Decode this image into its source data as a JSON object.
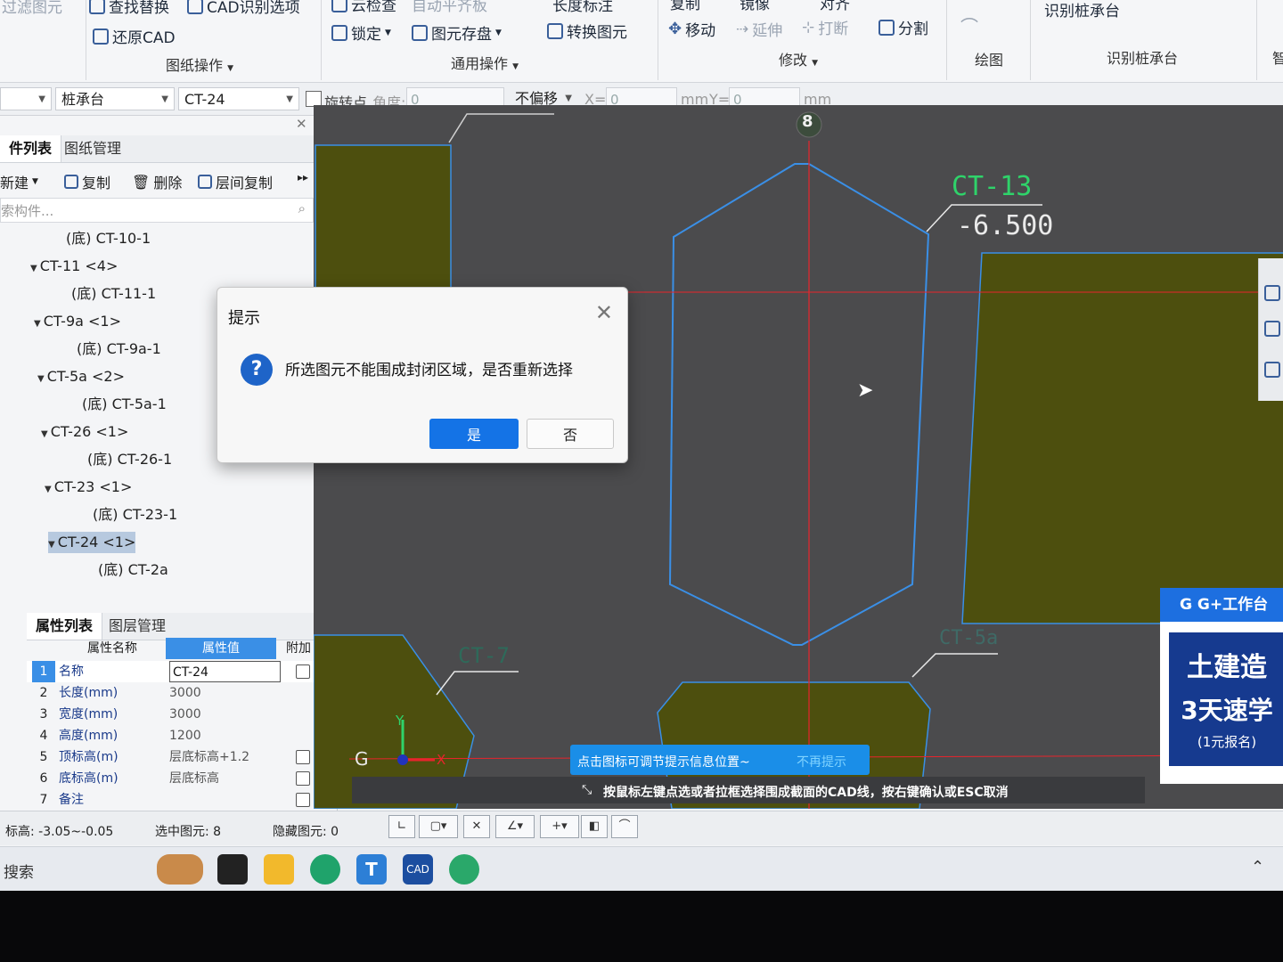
{
  "ribbon": {
    "top_row": [
      "过滤图元",
      "查找替换",
      "CAD识别选项",
      "云检查",
      "自动平齐板",
      "长度标注",
      "复制",
      "镜像",
      "对齐",
      "识别桩承台"
    ],
    "row2": {
      "restore_cad": "还原CAD",
      "lock": "锁定",
      "element_save": "图元存盘",
      "convert_element": "转换图元",
      "move": "移动",
      "extend": "延伸",
      "break": "打断",
      "split": "分割"
    },
    "groups": {
      "drawing_ops": "图纸操作",
      "common_ops": "通用操作",
      "modify": "修改",
      "draw": "绘图",
      "identify_cap": "识别桩承台",
      "smart": "智"
    }
  },
  "toolbar2": {
    "type_combo": "桩承台",
    "name_combo": "CT-24",
    "rotate_label": "旋转点",
    "angle_label": "角度:",
    "angle_value": "0",
    "offset_combo": "不偏移",
    "x_label": "X=",
    "x_value": "0",
    "mm1": "mm",
    "y_label": "Y=",
    "y_value": "0",
    "mm2": "mm"
  },
  "left_panel": {
    "tabs": [
      "件列表",
      "图纸管理"
    ],
    "new": "新建",
    "copy": "复制",
    "delete": "删除",
    "floor_copy": "层间复制",
    "search_placeholder": "索构件...",
    "tree": [
      {
        "label": "(底) CT-10-1",
        "level": 2
      },
      {
        "label": "CT-11 <4>",
        "level": 1
      },
      {
        "label": "(底) CT-11-1",
        "level": 2
      },
      {
        "label": "CT-9a <1>",
        "level": 1
      },
      {
        "label": "(底) CT-9a-1",
        "level": 2
      },
      {
        "label": "CT-5a <2>",
        "level": 1
      },
      {
        "label": "(底) CT-5a-1",
        "level": 2
      },
      {
        "label": "CT-26 <1>",
        "level": 1
      },
      {
        "label": "(底) CT-26-1",
        "level": 2
      },
      {
        "label": "CT-23 <1>",
        "level": 1
      },
      {
        "label": "(底) CT-23-1",
        "level": 2
      },
      {
        "label": "CT-24 <1>",
        "level": 1,
        "selected": true
      },
      {
        "label": "(底) CT-2a",
        "level": 2
      }
    ]
  },
  "properties": {
    "tabs": [
      "属性列表",
      "图层管理"
    ],
    "headers": [
      "属性名称",
      "属性值",
      "附加"
    ],
    "rows": [
      {
        "num": "1",
        "name": "名称",
        "value": "CT-24",
        "check": true
      },
      {
        "num": "2",
        "name": "长度(mm)",
        "value": "3000",
        "check": false
      },
      {
        "num": "3",
        "name": "宽度(mm)",
        "value": "3000",
        "check": false
      },
      {
        "num": "4",
        "name": "高度(mm)",
        "value": "1200",
        "check": false
      },
      {
        "num": "5",
        "name": "顶标高(m)",
        "value": "层底标高+1.2",
        "check": true
      },
      {
        "num": "6",
        "name": "底标高(m)",
        "value": "层底标高",
        "check": true
      },
      {
        "num": "7",
        "name": "备注",
        "value": "",
        "check": true
      }
    ]
  },
  "canvas": {
    "axis_label": "8",
    "label_ct13": "CT-13",
    "label_elev": "-6.500",
    "label_ct7": "CT-7",
    "label_ct5a": "CT-5a",
    "g_label": "G",
    "x_axis": "X",
    "y_axis": "Y"
  },
  "hint": {
    "bubble": "点击图标可调节提示信息位置~",
    "dont_show": "不再提示",
    "command": "按鼠标左键点选或者拉框选择围成截面的CAD线，按右键确认或ESC取消"
  },
  "status": {
    "elevation": "标高:  -3.05~-0.05",
    "selected": "选中图元:  8",
    "hidden": "隐藏图元:  0"
  },
  "dialog": {
    "title": "提示",
    "message": "所选图元不能围成封闭区域，是否重新选择",
    "yes": "是",
    "no": "否"
  },
  "ad": {
    "header": "G+工作台",
    "line1": "土建造",
    "line2": "3天速学",
    "line3": "(1元报名)"
  },
  "taskbar": {
    "search": "搜索"
  },
  "colors": {
    "canvas_bg": "#4b4b4d",
    "olive_fill": "#4d4f0e",
    "cad_blue": "#3a8fe6",
    "axis_red": "#e8242c",
    "label_green": "#2fd36a",
    "accent_blue": "#1473e6"
  }
}
